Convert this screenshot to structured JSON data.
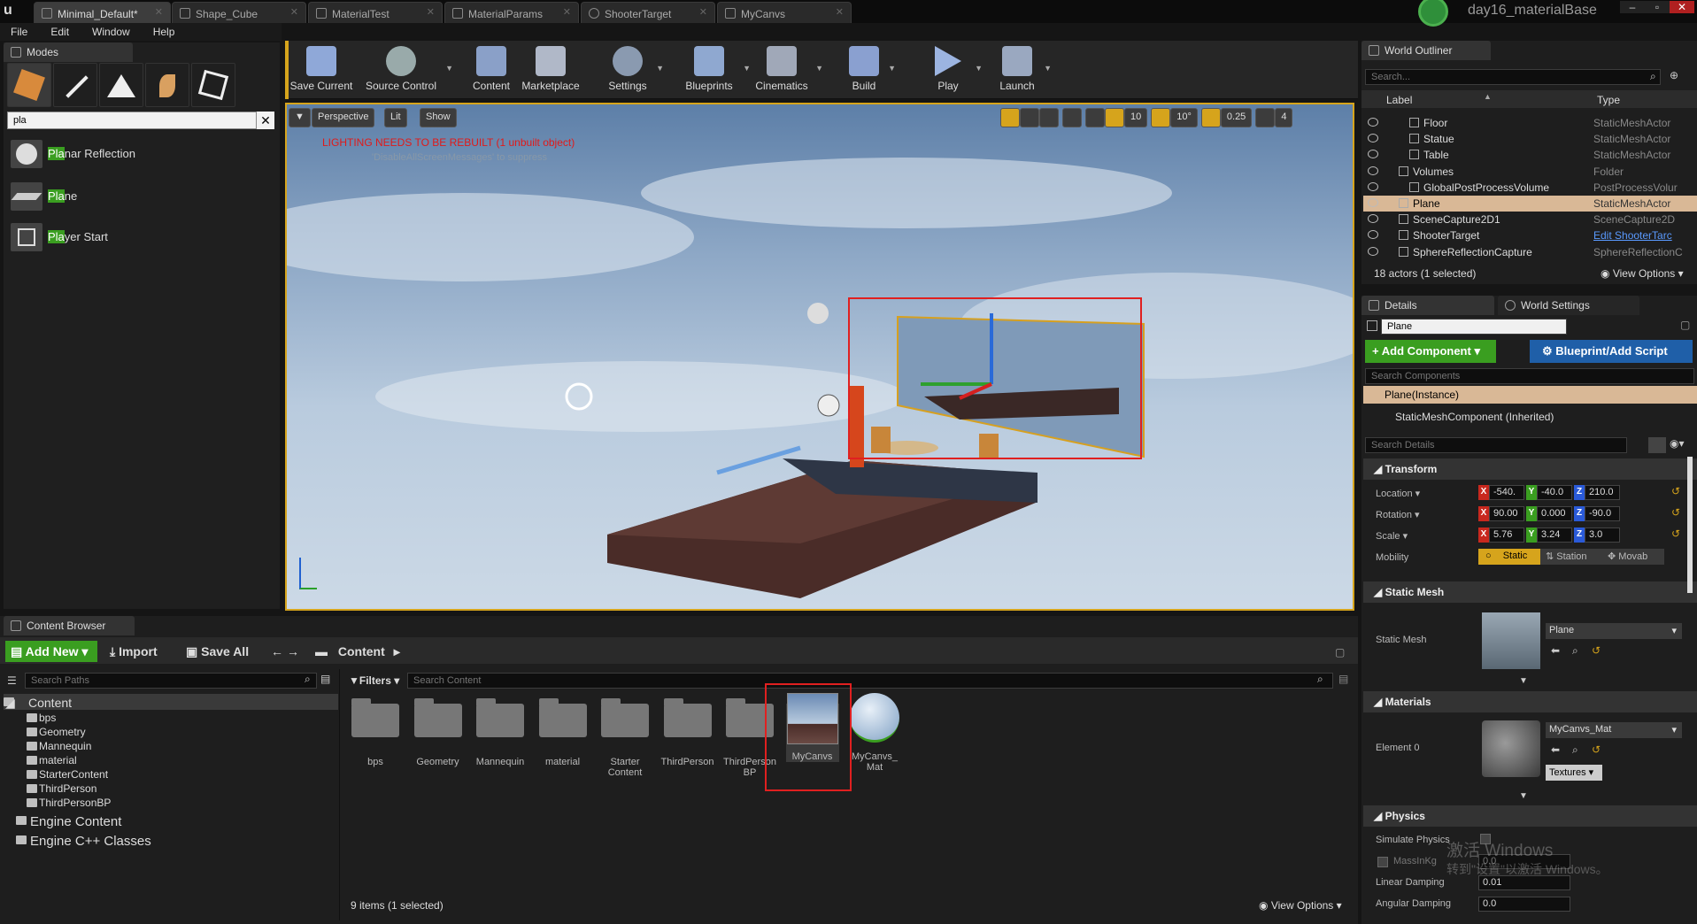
{
  "titlebar": {
    "tabs": [
      "Minimal_Default*",
      "Shape_Cube",
      "MaterialTest",
      "MaterialParams",
      "ShooterTarget",
      "MyCanvs"
    ],
    "project": "day16_materialBase"
  },
  "menu": [
    "File",
    "Edit",
    "Window",
    "Help"
  ],
  "modes": {
    "tab_label": "Modes",
    "search_value": "pla",
    "items": [
      {
        "prefix": "Pla",
        "rest": "nar Reflection"
      },
      {
        "prefix": "Pla",
        "rest": "ne"
      },
      {
        "prefix": "Pla",
        "rest": "yer Start"
      }
    ],
    "help_glyph": "?"
  },
  "toolbar": {
    "buttons": [
      "Save Current",
      "Source Control",
      "Content",
      "Marketplace",
      "Settings",
      "Blueprints",
      "Cinematics",
      "Build",
      "Play",
      "Launch"
    ]
  },
  "viewport": {
    "perspective": "Perspective",
    "lit": "Lit",
    "show": "Show",
    "warning": "LIGHTING NEEDS TO BE REBUILT (1 unbuilt object)",
    "suppress": "'DisableAllScreenMessages' to suppress",
    "grid_snap": "10",
    "rot_snap": "10°",
    "scale_snap": "0.25",
    "cam_speed": "4"
  },
  "outliner": {
    "tab_label": "World Outliner",
    "search_placeholder": "Search...",
    "col_label": "Label",
    "col_type": "Type",
    "rows": [
      {
        "label": "Floor",
        "type": "StaticMeshActor",
        "indent": 2
      },
      {
        "label": "Statue",
        "type": "StaticMeshActor",
        "indent": 2
      },
      {
        "label": "Table",
        "type": "StaticMeshActor",
        "indent": 2
      },
      {
        "label": "Volumes",
        "type": "Folder",
        "indent": 1
      },
      {
        "label": "GlobalPostProcessVolume",
        "type": "PostProcessVolur",
        "indent": 2
      },
      {
        "label": "Plane",
        "type": "StaticMeshActor",
        "indent": 1,
        "selected": true
      },
      {
        "label": "SceneCapture2D1",
        "type": "SceneCapture2D",
        "indent": 1
      },
      {
        "label": "ShooterTarget",
        "type": "Edit ShooterTarc",
        "indent": 1,
        "link": true
      },
      {
        "label": "SphereReflectionCapture",
        "type": "SphereReflectionC",
        "indent": 1
      }
    ],
    "status": "18 actors (1 selected)",
    "view_options": "View Options"
  },
  "details": {
    "tab_details": "Details",
    "tab_world": "World Settings",
    "name": "Plane",
    "add_component": "Add Component",
    "blueprint": "Blueprint/Add Script",
    "search_components": "Search Components",
    "instance": "Plane(Instance)",
    "component": "StaticMeshComponent (Inherited)",
    "search_details": "Search Details",
    "transform": {
      "header": "Transform",
      "location_label": "Location",
      "rotation_label": "Rotation",
      "scale_label": "Scale",
      "mobility_label": "Mobility",
      "location": [
        "-540.",
        "-40.0",
        "210.0"
      ],
      "rotation": [
        "90.00",
        "0.000",
        "-90.0"
      ],
      "scale": [
        "5.76",
        "3.24",
        "3.0"
      ],
      "mobility": [
        "Static",
        "Station",
        "Movab"
      ]
    },
    "static_mesh": {
      "header": "Static Mesh",
      "label": "Static Mesh",
      "value": "Plane"
    },
    "materials": {
      "header": "Materials",
      "label": "Element 0",
      "value": "MyCanvs_Mat",
      "textures": "Textures"
    },
    "physics": {
      "header": "Physics",
      "simulate": "Simulate Physics",
      "mass": "MassInKg",
      "mass_value": "0.0",
      "linear": "Linear Damping",
      "linear_value": "0.01",
      "angular": "Angular Damping",
      "angular_value": "0.0"
    },
    "watermark_1": "激活 Windows",
    "watermark_2": "转到\"设置\"以激活 Windows。"
  },
  "content_browser": {
    "tab_label": "Content Browser",
    "add_new": "Add New",
    "import": "Import",
    "save_all": "Save All",
    "path": "Content",
    "search_paths": "Search Paths",
    "filters": "Filters",
    "search_content": "Search Content",
    "tree": [
      "Content",
      "bps",
      "Geometry",
      "Mannequin",
      "material",
      "StarterContent",
      "ThirdPerson",
      "ThirdPersonBP",
      "Engine Content",
      "Engine C++ Classes"
    ],
    "assets": [
      "bps",
      "Geometry",
      "Mannequin",
      "material",
      "Starter Content",
      "ThirdPerson",
      "ThirdPerson BP",
      "MyCanvs",
      "MyCanvs_ Mat"
    ],
    "status": "9 items (1 selected)",
    "view_options": "View Options"
  }
}
